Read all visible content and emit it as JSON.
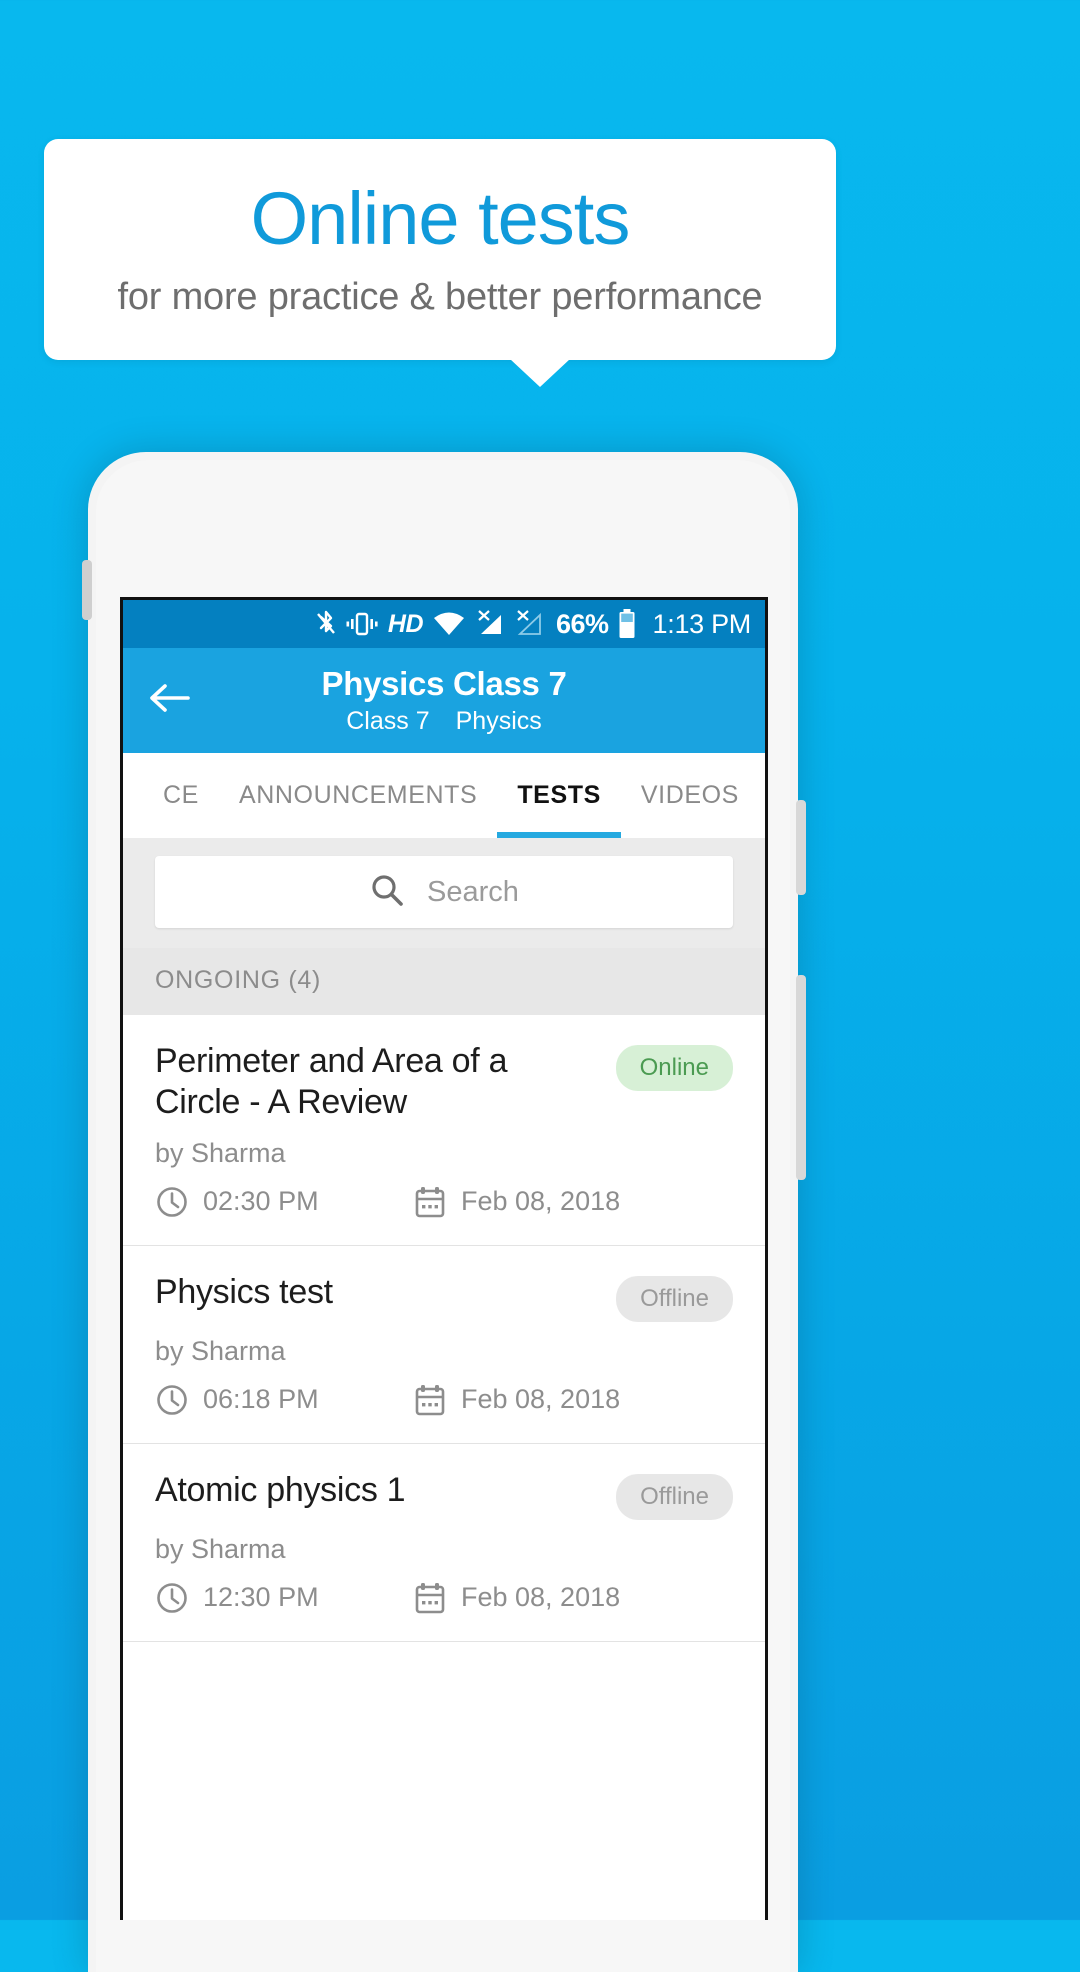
{
  "promo": {
    "title": "Online tests",
    "subtitle": "for more practice & better performance",
    "accent_color": "#109ada",
    "background_color": "#07b0eb"
  },
  "status_bar": {
    "icons": [
      "bluetooth-icon",
      "vibrate-icon",
      "hd-icon",
      "wifi-icon",
      "signal-no-sim-1-icon",
      "signal-no-sim-2-icon"
    ],
    "hd_label": "HD",
    "battery_percent": "66%",
    "time": "1:13 PM",
    "background_color": "#0480c0"
  },
  "app_bar": {
    "back_icon": "arrow-left-icon",
    "title": "Physics Class 7",
    "subtitle_class": "Class 7",
    "subtitle_subject": "Physics",
    "background_color": "#1aa3e0"
  },
  "tabs": [
    {
      "label": "CE",
      "active": false
    },
    {
      "label": "ANNOUNCEMENTS",
      "active": false
    },
    {
      "label": "TESTS",
      "active": true
    },
    {
      "label": "VIDEOS",
      "active": false
    }
  ],
  "search": {
    "icon": "search-icon",
    "placeholder": "Search",
    "value": ""
  },
  "section": {
    "label": "ONGOING (4)"
  },
  "tests": [
    {
      "title": "Perimeter and Area of a Circle - A Review",
      "author": "by Sharma",
      "status": "Online",
      "status_type": "online",
      "time": "02:30 PM",
      "date": "Feb 08, 2018",
      "time_icon": "clock-icon",
      "date_icon": "calendar-icon"
    },
    {
      "title": "Physics test",
      "author": "by Sharma",
      "status": "Offline",
      "status_type": "offline",
      "time": "06:18 PM",
      "date": "Feb 08, 2018",
      "time_icon": "clock-icon",
      "date_icon": "calendar-icon"
    },
    {
      "title": "Atomic physics 1",
      "author": "by Sharma",
      "status": "Offline",
      "status_type": "offline",
      "time": "12:30 PM",
      "date": "Feb 08, 2018",
      "time_icon": "clock-icon",
      "date_icon": "calendar-icon"
    }
  ]
}
